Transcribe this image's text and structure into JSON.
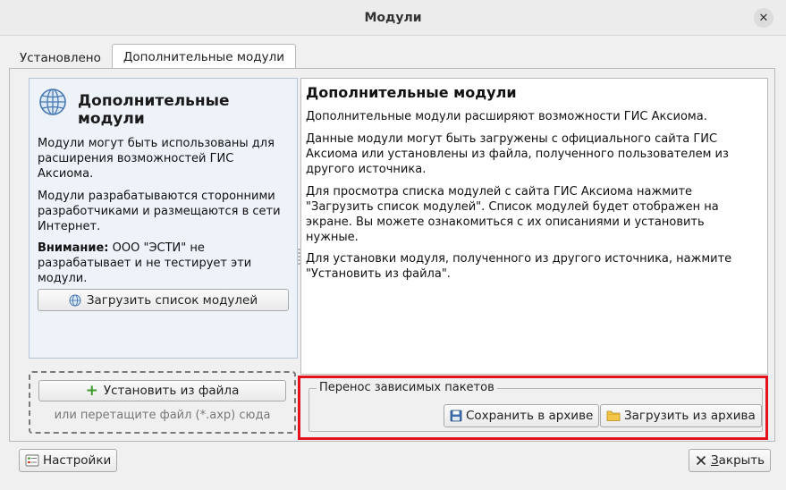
{
  "window": {
    "title": "Модули",
    "close_glyph": "✕"
  },
  "tabs": [
    {
      "label": "Установлено",
      "active": false
    },
    {
      "label": "Дополнительные модули",
      "active": true
    }
  ],
  "left_panel": {
    "title": "Дополнительные модули",
    "para1": "Модули могут быть использованы для расширения возможностей ГИС Аксиома.",
    "para2": "Модули разрабатываются сторонними разработчиками и размещаются в сети Интернет.",
    "warning_label": "Внимание:",
    "warning_text": " ООО \"ЭСТИ\" не разрабатывает и не тестирует эти модули.",
    "load_list_button": "Загрузить список модулей"
  },
  "right_panel": {
    "title": "Дополнительные модули",
    "para1": "Дополнительные модули расширяют возможности ГИС Аксиома.",
    "para2": "Данные модули могут быть загружены с официального сайта ГИС Аксиома или установлены из файла, полученного пользователем из другого источника.",
    "para3": "Для просмотра списка модулей с сайта ГИС Аксиома нажмите \"Загрузить список модулей\". Список модулей будет отображен на экране. Вы можете ознакомиться с их описаниями и установить нужные.",
    "para4": "Для установки модуля, полученного из другого источника, нажмите \"Установить из файла\"."
  },
  "drop_zone": {
    "install_button": "Установить из файла",
    "hint": "или перетащите файл (*.axp) сюда"
  },
  "dependencies_group": {
    "title": "Перенос зависимых пакетов",
    "save_button": "Сохранить в архиве",
    "load_button": "Загрузить из архива"
  },
  "footer": {
    "settings_button": "Настройки",
    "close_button_accel": "З",
    "close_button_rest": "акрыть"
  },
  "colors": {
    "highlight_border": "#e1131f",
    "left_panel_bg": "#eef3fa",
    "plus_icon": "#3c9b2c"
  },
  "icons": {
    "globe": "globe-icon",
    "plus": "plus-icon",
    "floppy": "floppy-disk-icon",
    "folder": "folder-icon",
    "settings": "settings-icon",
    "close": "close-icon"
  }
}
